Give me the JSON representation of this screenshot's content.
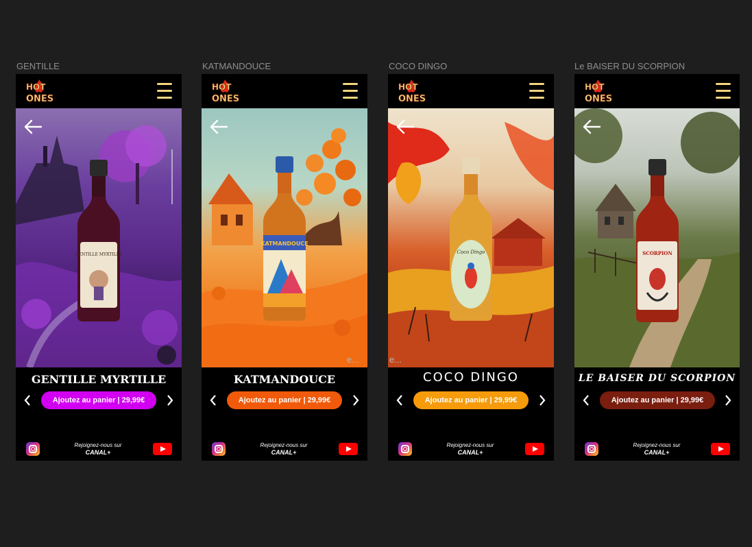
{
  "frames": [
    {
      "label": "GENTILLE",
      "product_title": "GENTILLE MYRTILLE",
      "bottle_label_text": "GENTILLE MYRTILLE",
      "cart_button": "Ajoutez au panier | 29,99€",
      "button_color": "#d200f0",
      "footer": {
        "join_text": "Rejoignez-nous sur",
        "channel": "CANAL+"
      }
    },
    {
      "label": "KATMANDOUCE",
      "product_title": "KATMANDOUCE",
      "bottle_label_text": "KATMANDOUCE",
      "cart_button": "Ajoutez au panier | 29,99€",
      "button_color": "#f05a0a",
      "hero_ellipsis": "e...",
      "footer": {
        "join_text": "Rejoignez-nous sur",
        "channel": "CANAL+"
      }
    },
    {
      "label": "COCO DINGO",
      "product_title": "COCO DINGO",
      "bottle_label_text": "Coco Dingo",
      "cart_button": "Ajoutez au panier | 29,99€",
      "button_color": "#f59b0c",
      "hero_ellipsis": "e...",
      "footer": {
        "join_text": "Rejoignez-nous sur",
        "channel": "CANAL+"
      }
    },
    {
      "label": "Le BAISER DU SCORPION",
      "product_title": "LE BAISER DU SCORPION",
      "bottle_label_text": "SCORPION",
      "cart_button": "Ajoutez au panier | 29,99€",
      "button_color": "#7a1e10",
      "footer": {
        "join_text": "Rejoignez-nous sur",
        "channel": "CANAL+"
      }
    }
  ],
  "logo_text": {
    "line1": "HOT",
    "line2": "ONES"
  },
  "icons": {
    "back": "arrow-left-icon",
    "menu": "hamburger-menu-icon",
    "prev": "chevron-left-icon",
    "next": "chevron-right-icon",
    "instagram": "instagram-icon",
    "youtube": "youtube-icon"
  },
  "colors": {
    "accent_gold": "#f3d57e",
    "flame": "#e0281a"
  }
}
